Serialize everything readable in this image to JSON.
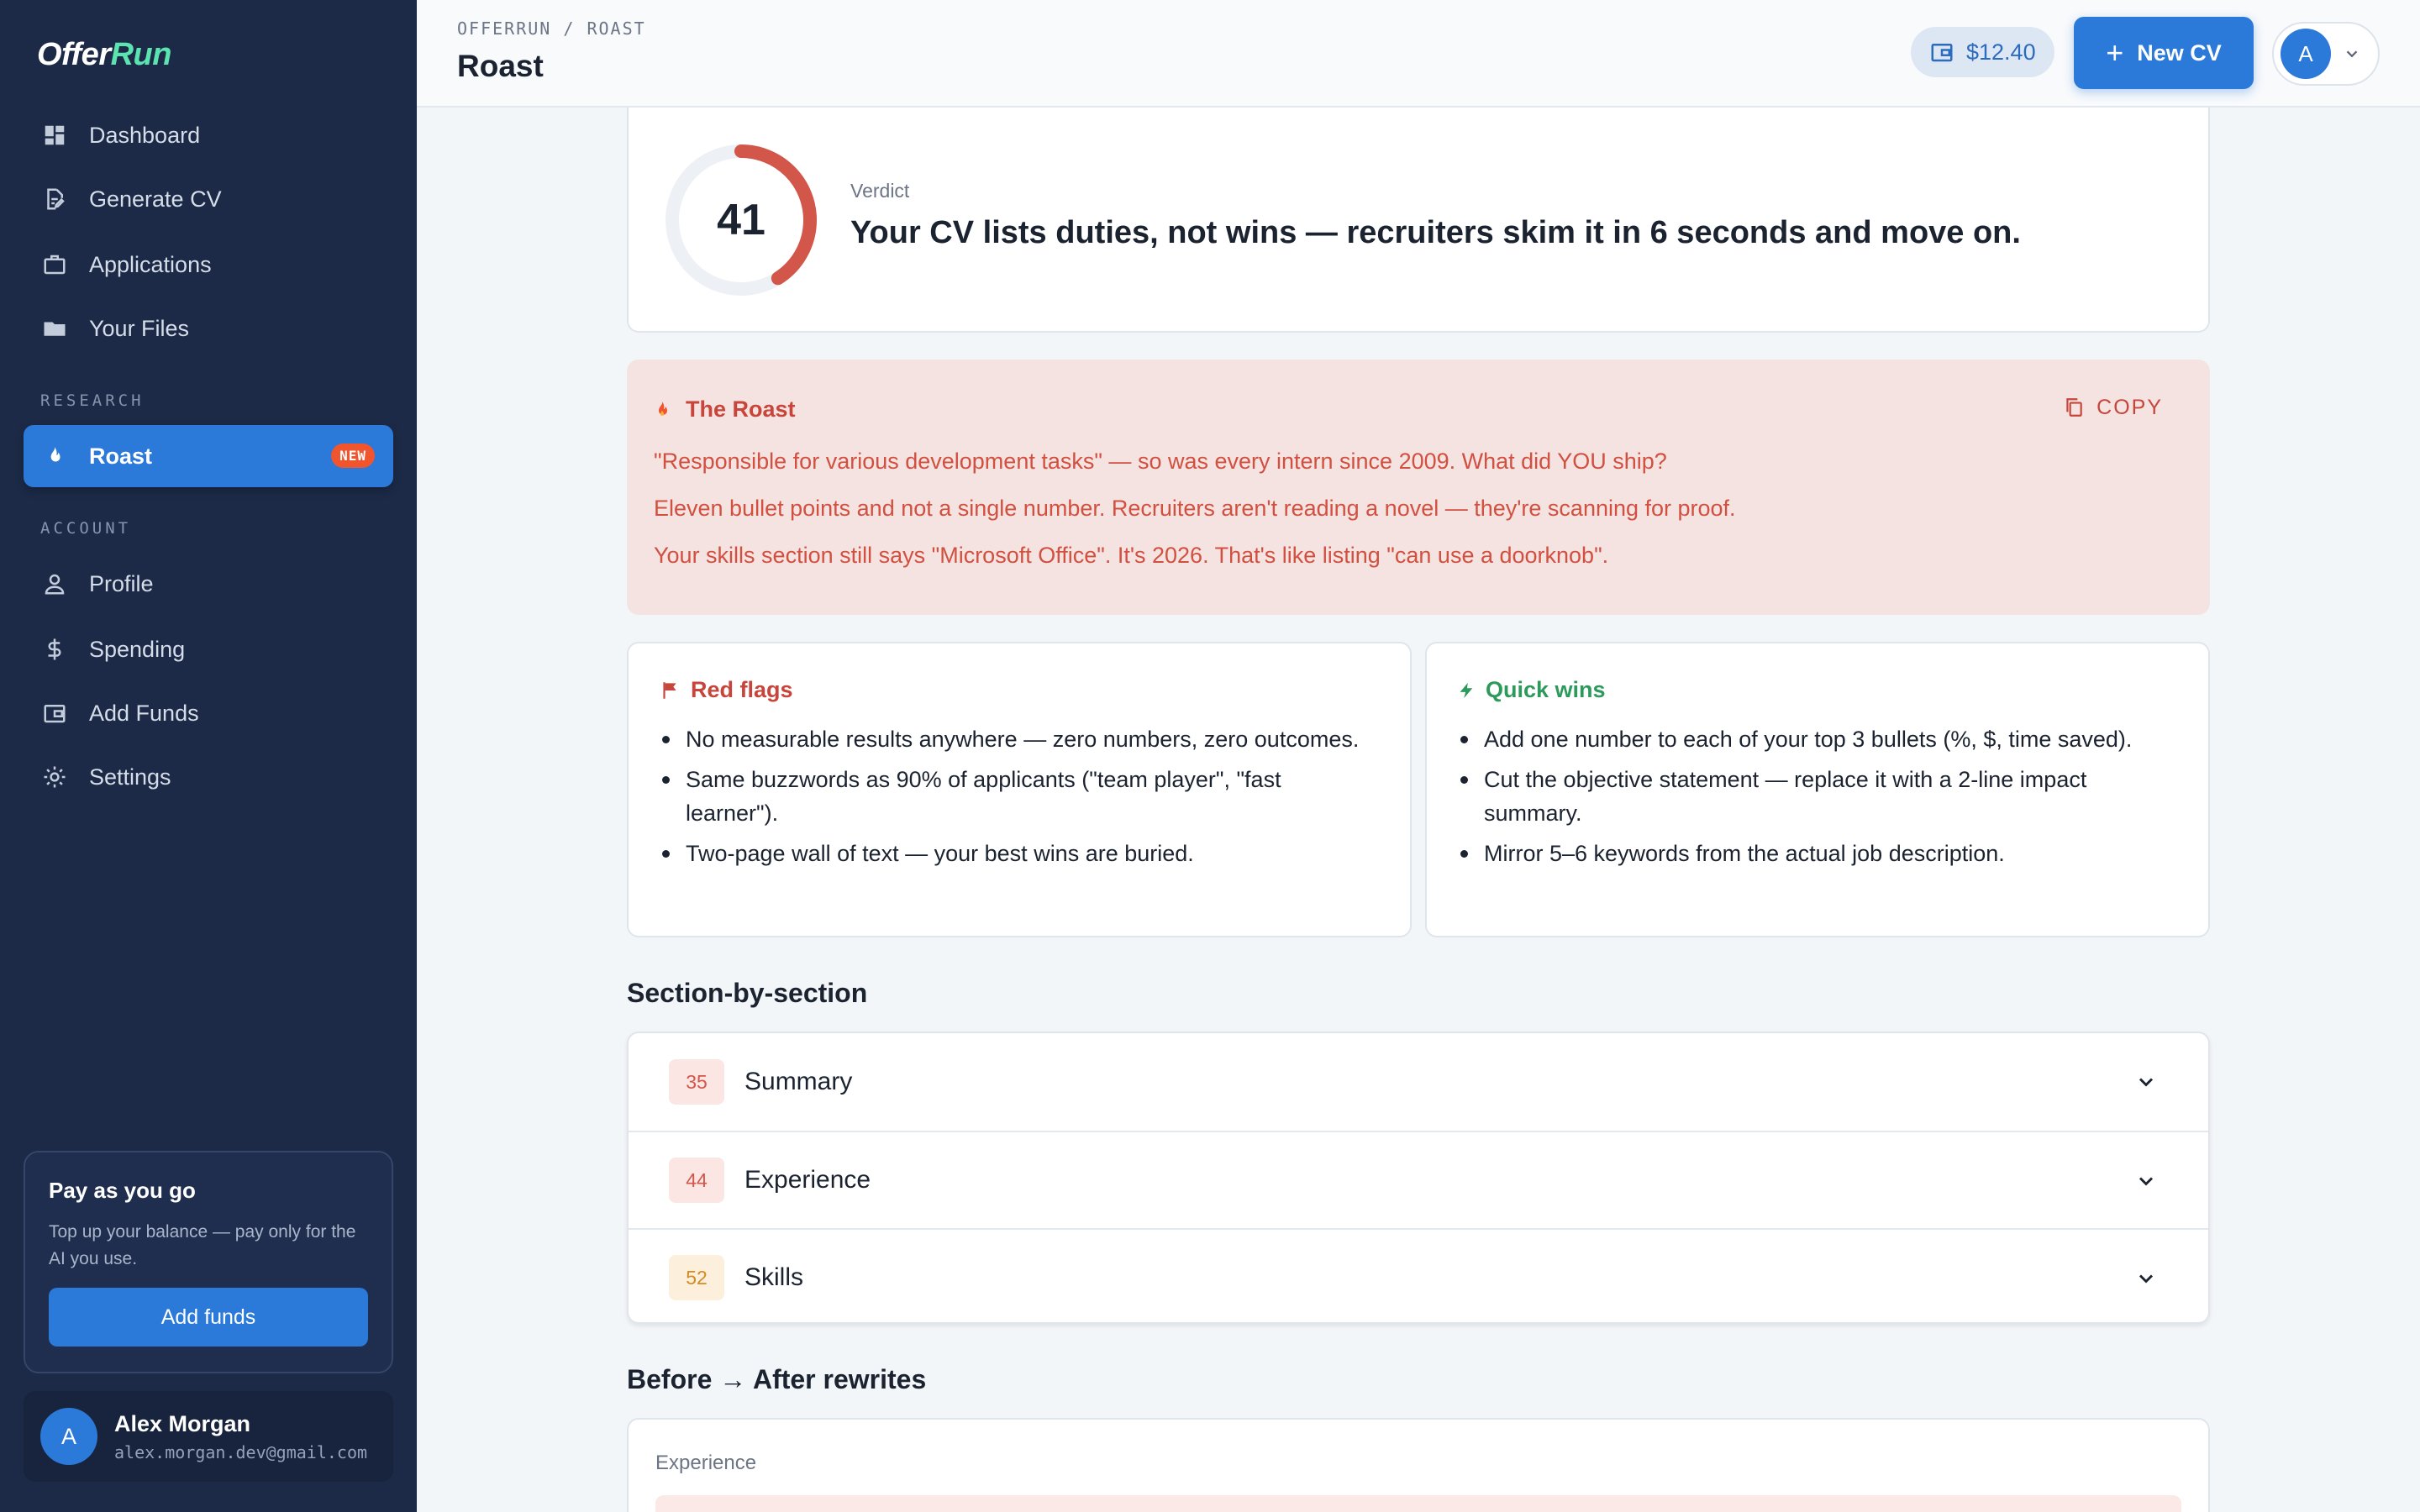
{
  "app": {
    "logo_main": "Offer",
    "logo_accent": "Run"
  },
  "sidebar": {
    "nav": [
      {
        "label": "Dashboard",
        "icon": "dashboard-icon"
      },
      {
        "label": "Generate CV",
        "icon": "edit-document-icon"
      },
      {
        "label": "Applications",
        "icon": "briefcase-icon"
      },
      {
        "label": "Your Files",
        "icon": "folder-icon"
      }
    ],
    "research_label": "RESEARCH",
    "research": [
      {
        "label": "Roast",
        "icon": "flame-icon",
        "badge": "NEW",
        "active": true
      }
    ],
    "account_label": "ACCOUNT",
    "account": [
      {
        "label": "Profile",
        "icon": "person-icon"
      },
      {
        "label": "Spending",
        "icon": "dollar-icon"
      },
      {
        "label": "Add Funds",
        "icon": "wallet-icon"
      },
      {
        "label": "Settings",
        "icon": "gear-icon"
      }
    ],
    "paycard": {
      "title": "Pay as you go",
      "text": "Top up your balance — pay only for the AI you use.",
      "button": "Add funds"
    },
    "user": {
      "initial": "A",
      "name": "Alex Morgan",
      "email": "alex.morgan.dev@gmail.com"
    }
  },
  "header": {
    "breadcrumb": "OFFERRUN / ROAST",
    "title": "Roast",
    "balance": "$12.40",
    "new_cv": "New CV",
    "user_initial": "A"
  },
  "verdict": {
    "score": "41",
    "score_value": 41,
    "score_max": 100,
    "label": "Verdict",
    "text": "Your CV lists duties, not wins — recruiters skim it in 6 seconds and move on."
  },
  "roast": {
    "title": "The Roast",
    "copy_label": "COPY",
    "lines": [
      "\"Responsible for various development tasks\" — so was every intern since 2009. What did YOU ship?",
      "Eleven bullet points and not a single number. Recruiters aren't reading a novel — they're scanning for proof.",
      "Your skills section still says \"Microsoft Office\". It's 2026. That's like listing \"can use a doorknob\"."
    ]
  },
  "red_flags": {
    "title": "Red flags",
    "items": [
      "No measurable results anywhere — zero numbers, zero outcomes.",
      "Same buzzwords as 90% of applicants (\"team player\", \"fast learner\").",
      "Two-page wall of text — your best wins are buried."
    ]
  },
  "quick_wins": {
    "title": "Quick wins",
    "items": [
      "Add one number to each of your top 3 bullets (%, $, time saved).",
      "Cut the objective statement — replace it with a 2-line impact summary.",
      "Mirror 5–6 keywords from the actual job description."
    ]
  },
  "sections": {
    "heading": "Section-by-section",
    "rows": [
      {
        "score": "35",
        "label": "Summary",
        "tone": "red"
      },
      {
        "score": "44",
        "label": "Experience",
        "tone": "red"
      },
      {
        "score": "52",
        "label": "Skills",
        "tone": "amber"
      }
    ]
  },
  "rewrites": {
    "heading": "Before → After rewrites",
    "first_label": "Experience"
  },
  "colors": {
    "sidebar_bg": "#1c2a47",
    "accent_blue": "#2b79d8",
    "logo_accent": "#5be3b0",
    "roast_red": "#c7453a",
    "win_green": "#2d9a5c"
  }
}
